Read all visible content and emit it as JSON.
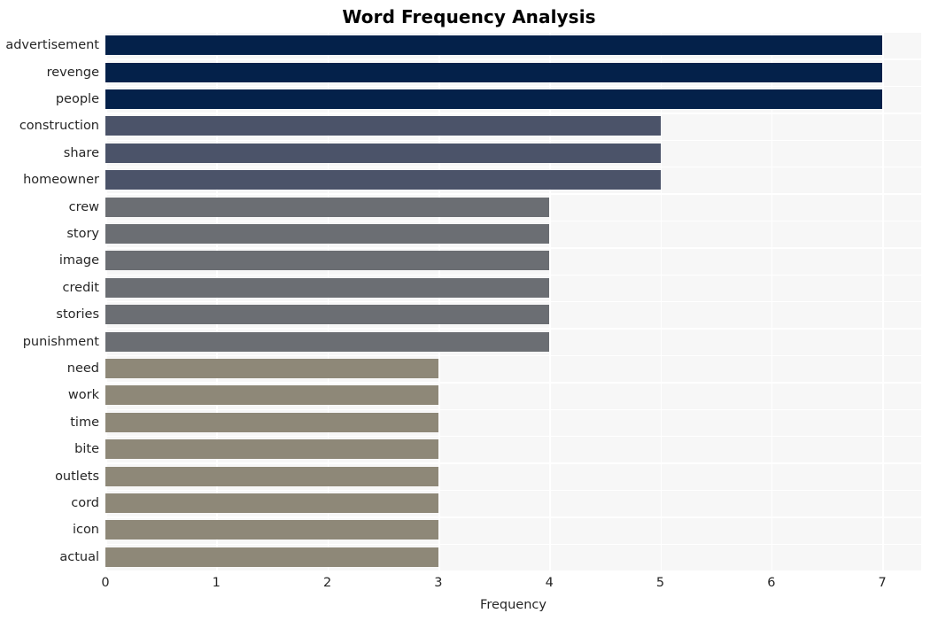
{
  "chart_data": {
    "type": "bar",
    "orientation": "horizontal",
    "title": "Word Frequency Analysis",
    "xlabel": "Frequency",
    "ylabel": "",
    "xlim": [
      0,
      7.35
    ],
    "ylim": [
      0,
      20
    ],
    "grid": true,
    "legend": null,
    "xticks": [
      "0",
      "1",
      "2",
      "3",
      "4",
      "5",
      "6",
      "7"
    ],
    "xtick_values": [
      0,
      1,
      2,
      3,
      4,
      5,
      6,
      7
    ],
    "categories": [
      "advertisement",
      "revenge",
      "people",
      "construction",
      "share",
      "homeowner",
      "crew",
      "story",
      "image",
      "credit",
      "stories",
      "punishment",
      "need",
      "work",
      "time",
      "bite",
      "outlets",
      "cord",
      "icon",
      "actual"
    ],
    "values": [
      7,
      7,
      7,
      5,
      5,
      5,
      4,
      4,
      4,
      4,
      4,
      4,
      3,
      3,
      3,
      3,
      3,
      3,
      3,
      3
    ],
    "bar_colors": [
      "#04214a",
      "#04214a",
      "#04214a",
      "#4b5369",
      "#4b5369",
      "#4b5369",
      "#6b6e73",
      "#6b6e73",
      "#6b6e73",
      "#6b6e73",
      "#6b6e73",
      "#6b6e73",
      "#8e8878",
      "#8e8878",
      "#8e8878",
      "#8e8878",
      "#8e8878",
      "#8e8878",
      "#8e8878",
      "#8e8878"
    ]
  },
  "style": {
    "plot_background": "#f7f7f7",
    "grid_color": "#ffffff",
    "figure_background": "#ffffff",
    "text_color": "#262626"
  }
}
